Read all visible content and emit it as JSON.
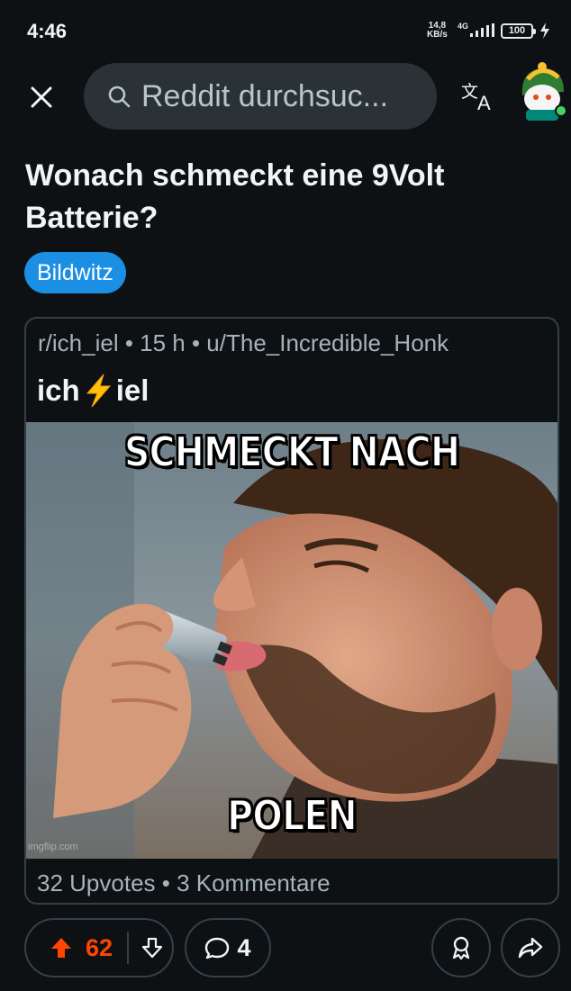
{
  "status_bar": {
    "time": "4:46",
    "net_speed_value": "14,8",
    "net_speed_unit": "KB/s",
    "network_type": "4G",
    "battery": "100"
  },
  "search": {
    "placeholder": "Reddit durchsuc..."
  },
  "post": {
    "title": "Wonach schmeckt eine 9Volt Batterie?",
    "flair": "Bildwitz"
  },
  "crosspost": {
    "meta": "r/ich_iel • 15 h • u/The_Incredible_Honk",
    "title_before": "ich",
    "title_after": "iel",
    "meme_top_text": "SCHMECKT NACH",
    "meme_bottom_text": "POLEN",
    "watermark": "imgflip.com",
    "stats": "32 Upvotes • 3 Kommentare"
  },
  "actions": {
    "vote_count": "62",
    "comment_count": "4"
  },
  "colors": {
    "background": "#0e1113",
    "accent_upvote": "#ff4500",
    "flair": "#1a8fe3",
    "border": "#33404a"
  }
}
